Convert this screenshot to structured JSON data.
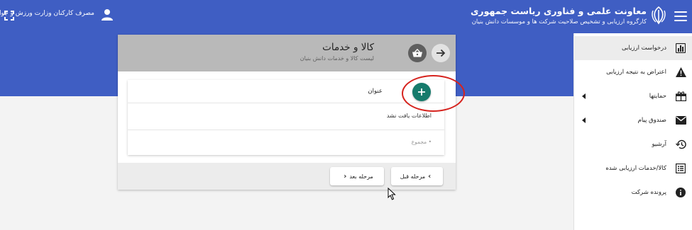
{
  "header": {
    "title": "معاونت علمی و فناوری ریاست جمهوری",
    "subtitle": "کارگروه ارزیابی و تشخیص صلاحیت شرکت ها و موسسات دانش بنیان",
    "user_name": "مصرف کارکنان وزارت ورزش و جوانان",
    "accent_color": "#3f5ec3"
  },
  "sidebar": {
    "items": [
      {
        "label": "درخواست ارزیابی",
        "icon": "bar-chart-icon",
        "active": true
      },
      {
        "label": "اعتراض به نتیجه ارزیابی",
        "icon": "warning-icon"
      },
      {
        "label": "حمایتها",
        "icon": "gift-icon",
        "has_arrow": true
      },
      {
        "label": "صندوق پیام",
        "icon": "mail-icon",
        "has_arrow": true
      },
      {
        "label": "آرشیو",
        "icon": "history-icon"
      },
      {
        "label": "کالا/خدمات ارزیابی شده",
        "icon": "list-icon"
      },
      {
        "label": "پرونده شرکت",
        "icon": "info-icon"
      }
    ]
  },
  "card": {
    "title": "کالا و خدمات",
    "subtitle": "لیست کالا و خدمات دانش بنیان",
    "table": {
      "column_title": "عنوان",
      "empty_message": "اطلاعات یافت نشد",
      "total_label": "• مجموع"
    },
    "footer": {
      "prev_label": "مرحله قبل",
      "next_label": "مرحله بعد"
    },
    "add_button_color": "#167b6c",
    "highlight_color": "#d6231e"
  }
}
